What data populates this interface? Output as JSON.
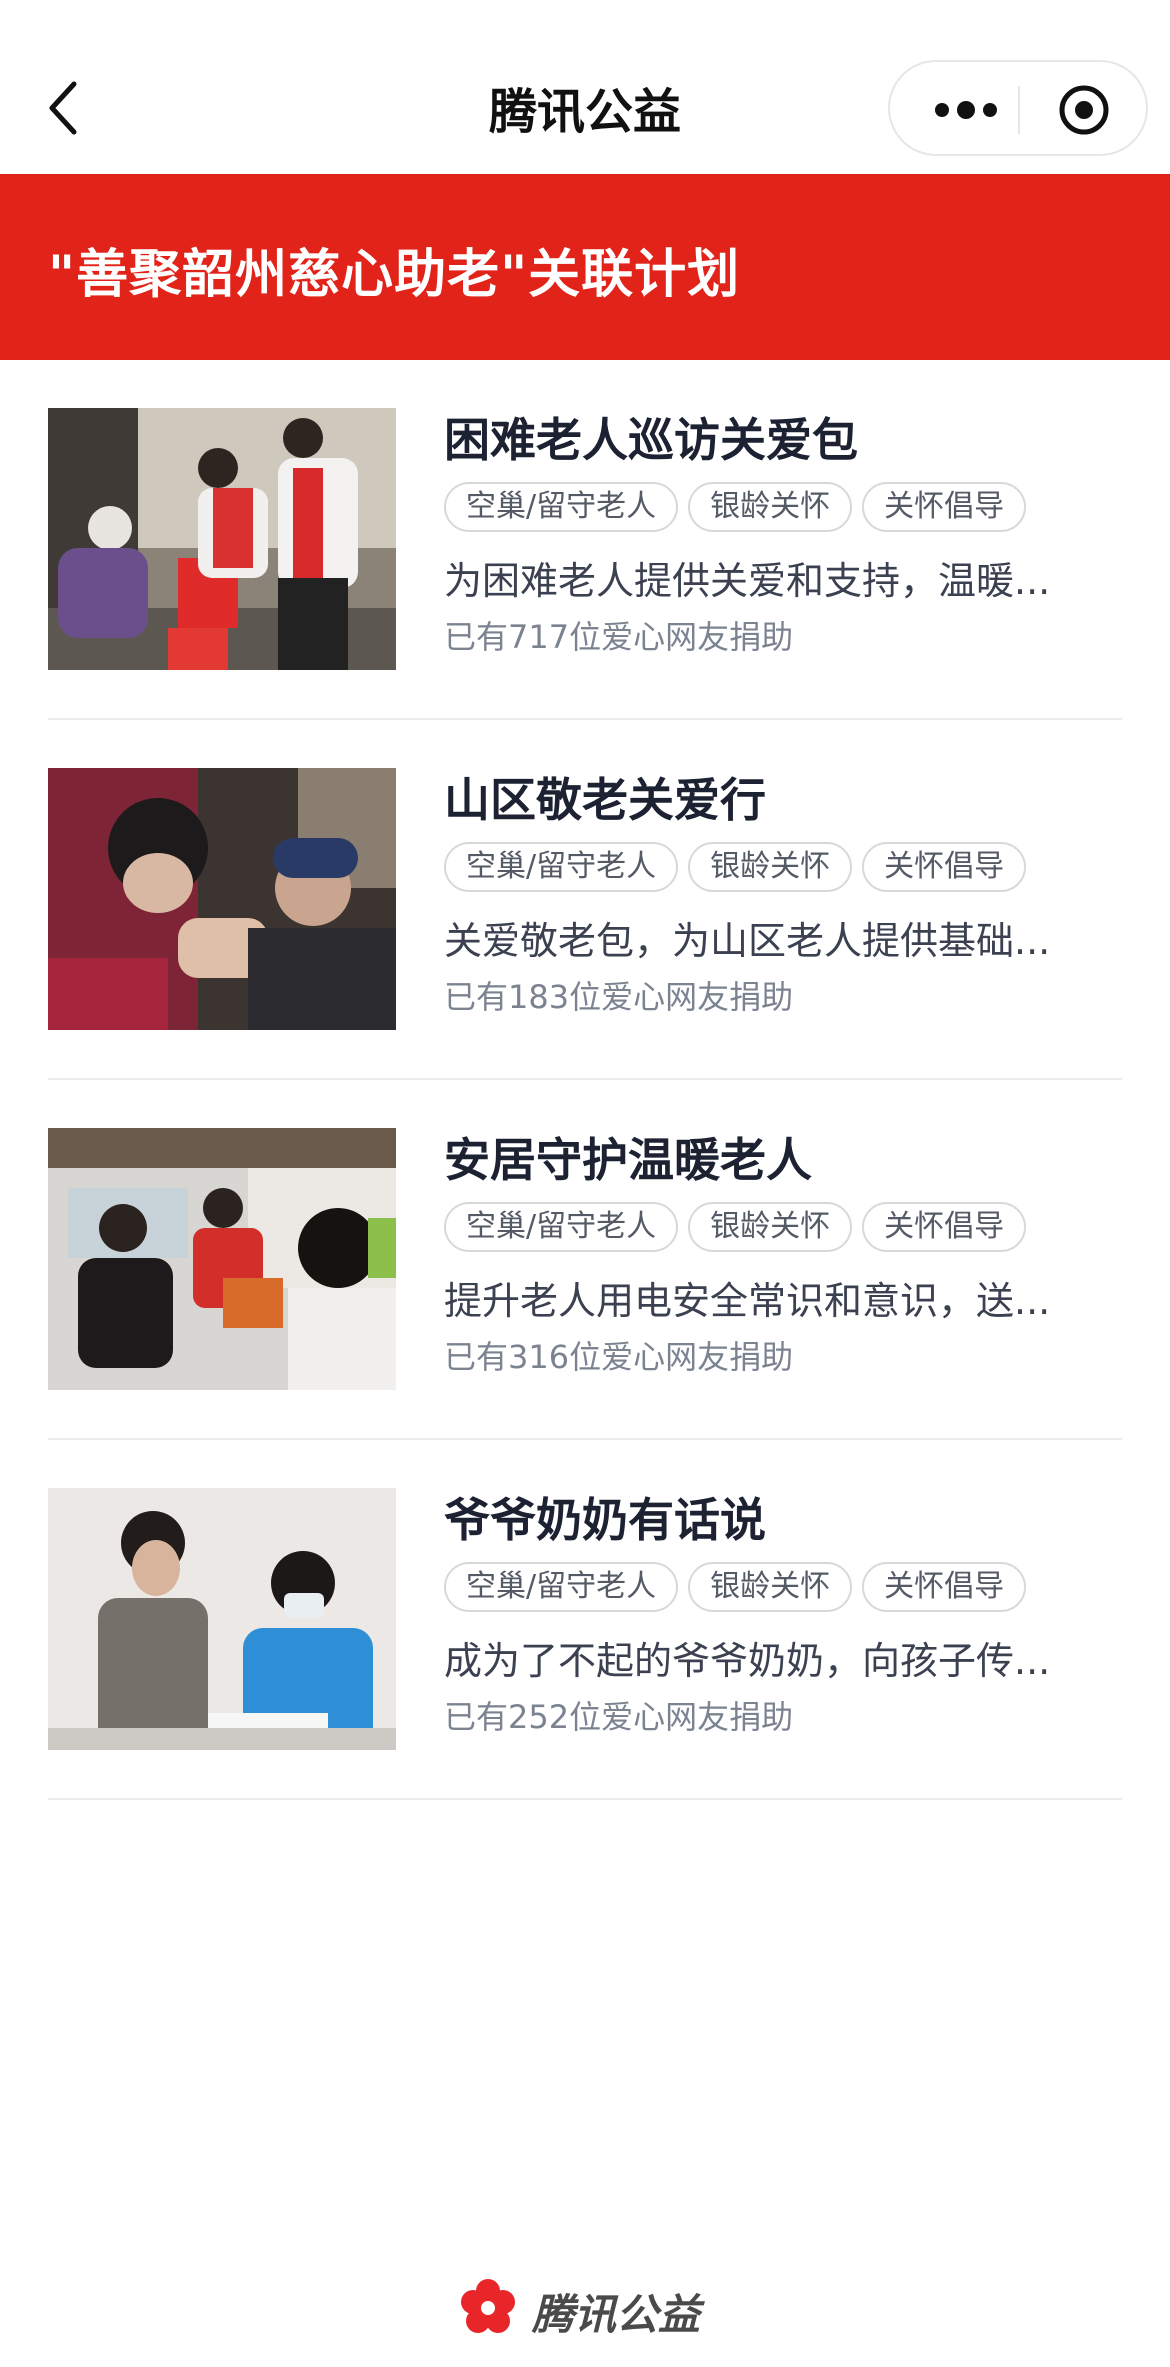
{
  "nav": {
    "title": "腾讯公益"
  },
  "banner": {
    "title": "\"善聚韶州慈心助老\"关联计划"
  },
  "colors": {
    "accent_red": "#e2231a",
    "brand_red": "#e8262a"
  },
  "projects": [
    {
      "title": "困难老人巡访关爱包",
      "tags": [
        "空巢/留守老人",
        "银龄关怀",
        "关怀倡导"
      ],
      "description": "为困难老人提供关爱和支持，温暖...",
      "donors": "已有717位爱心网友捐助"
    },
    {
      "title": "山区敬老关爱行",
      "tags": [
        "空巢/留守老人",
        "银龄关怀",
        "关怀倡导"
      ],
      "description": "关爱敬老包，为山区老人提供基础...",
      "donors": "已有183位爱心网友捐助"
    },
    {
      "title": "安居守护温暖老人",
      "tags": [
        "空巢/留守老人",
        "银龄关怀",
        "关怀倡导"
      ],
      "description": "提升老人用电安全常识和意识，送...",
      "donors": "已有316位爱心网友捐助"
    },
    {
      "title": "爷爷奶奶有话说",
      "tags": [
        "空巢/留守老人",
        "银龄关怀",
        "关怀倡导"
      ],
      "description": "成为了不起的爷爷奶奶，向孩子传...",
      "donors": "已有252位爱心网友捐助"
    }
  ],
  "footer": {
    "brand": "腾讯公益"
  }
}
